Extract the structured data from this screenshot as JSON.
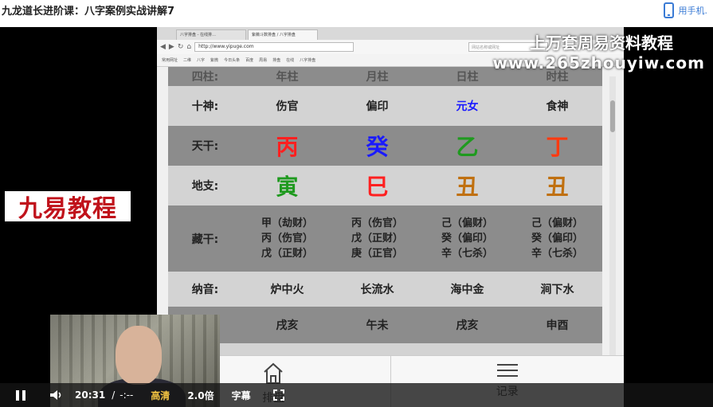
{
  "page": {
    "title": "九龙道长进阶课：八字案例实战讲解7",
    "mobile_link": "用手机.",
    "phone_icon": "phone-icon"
  },
  "video": {
    "logo_text": "九易教程",
    "watermark_line1": "上万套周易资料教程",
    "watermark_line2": "www.265zhouyiw.com"
  },
  "browser": {
    "tabs": [
      "八字排盘 - 在线排…",
      "紫薇斗数排盘 / 八字排盘"
    ],
    "address": "http://www.yipuge.com",
    "search_placeholder": "网站名称或网址",
    "bookmarks": [
      "常用网址",
      "二维",
      "八字",
      "紫微",
      "今日头条",
      "百度",
      "周易",
      "排盘",
      "在线",
      "八字排盘"
    ]
  },
  "bazi": {
    "header": {
      "label": "四柱:",
      "columns": [
        "年柱",
        "月柱",
        "日柱",
        "时柱"
      ]
    },
    "shishen": {
      "label": "十神:",
      "values": [
        "伤官",
        "偏印",
        "元女",
        "食神"
      ],
      "colors": [
        "#222222",
        "#222222",
        "#1a1aff",
        "#222222"
      ]
    },
    "tiangan": {
      "label": "天干:",
      "values": [
        "丙",
        "癸",
        "乙",
        "丁"
      ],
      "colors": [
        "#ff2020",
        "#1a1aff",
        "#1f9a1f",
        "#ff3a10"
      ]
    },
    "dizhi": {
      "label": "地支:",
      "values": [
        "寅",
        "巳",
        "丑",
        "丑"
      ],
      "colors": [
        "#1f9a1f",
        "#ff2020",
        "#c07010",
        "#c07010"
      ]
    },
    "canggan": {
      "label": "藏干:",
      "columns": [
        [
          "甲（劫财）",
          "丙（伤官）",
          "戊（正财）"
        ],
        [
          "丙（伤官）",
          "戊（正财）",
          "庚（正官）"
        ],
        [
          "己（偏财）",
          "癸（偏印）",
          "辛（七杀）"
        ],
        [
          "己（偏财）",
          "癸（偏印）",
          "辛（七杀）"
        ]
      ]
    },
    "nayin": {
      "label": "纳音:",
      "values": [
        "炉中火",
        "长流水",
        "海中金",
        "涧下水"
      ]
    },
    "xunkong": {
      "label": "",
      "values": [
        "戌亥",
        "午未",
        "戌亥",
        "申酉"
      ]
    }
  },
  "app_nav": {
    "home_label": "排盘",
    "records_label": "记录"
  },
  "controls": {
    "current_time": "20:31",
    "separator": "/",
    "duration": "-:--",
    "quality": "高清",
    "speed": "2.0倍",
    "subtitles": "字幕"
  }
}
